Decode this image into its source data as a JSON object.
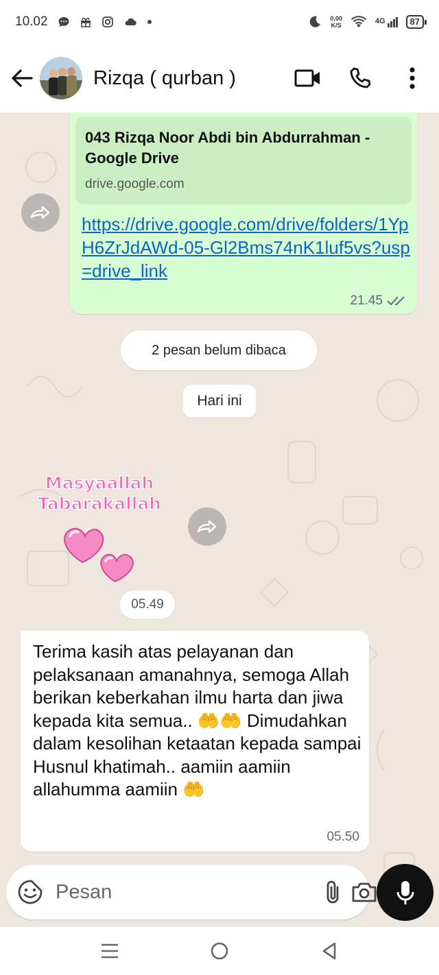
{
  "status_bar": {
    "time": "10.02",
    "net_speed_value": "0,00",
    "net_speed_unit": "K/S",
    "signal_label": "4G",
    "battery": "87"
  },
  "header": {
    "contact_name": "Rizqa ( qurban )",
    "icons": [
      "back-arrow-icon",
      "video-call-icon",
      "phone-icon",
      "more-vert-icon"
    ]
  },
  "messages": {
    "outgoing_link": {
      "preview_title": "043 Rizqa Noor Abdi bin Abdurrahman - Google Drive",
      "preview_domain": "drive.google.com",
      "link": "https://drive.google.com/drive/folders/1YpH6ZrJdAWd-05-Gl2Bms74nK1luf5vs?usp=drive_link",
      "time": "21.45",
      "status": "read"
    },
    "unread_banner": "2 pesan belum dibaca",
    "date_divider": "Hari ini",
    "sticker": {
      "line1": "Masyaallah",
      "line2": "Tabarakallah",
      "time": "05.49"
    },
    "incoming_text": {
      "text": "Terima kasih atas pelayanan dan pelaksanaan amanahnya, semoga Allah berikan keberkahan ilmu harta dan jiwa kepada kita semua.. 🤲🤲 Dimudahkan dalam kesolihan ketaatan kepada sampai Husnul khatimah.. aamiin aamiin allahumma aamiin 🤲",
      "time": "05.50"
    }
  },
  "input": {
    "placeholder": "Pesan"
  },
  "colors": {
    "outgoing_bubble": "#d9fdd3",
    "link": "#0a66c2",
    "chat_background": "#efe7de",
    "mic_button": "#111111",
    "sticker_text": "#f068b5"
  }
}
